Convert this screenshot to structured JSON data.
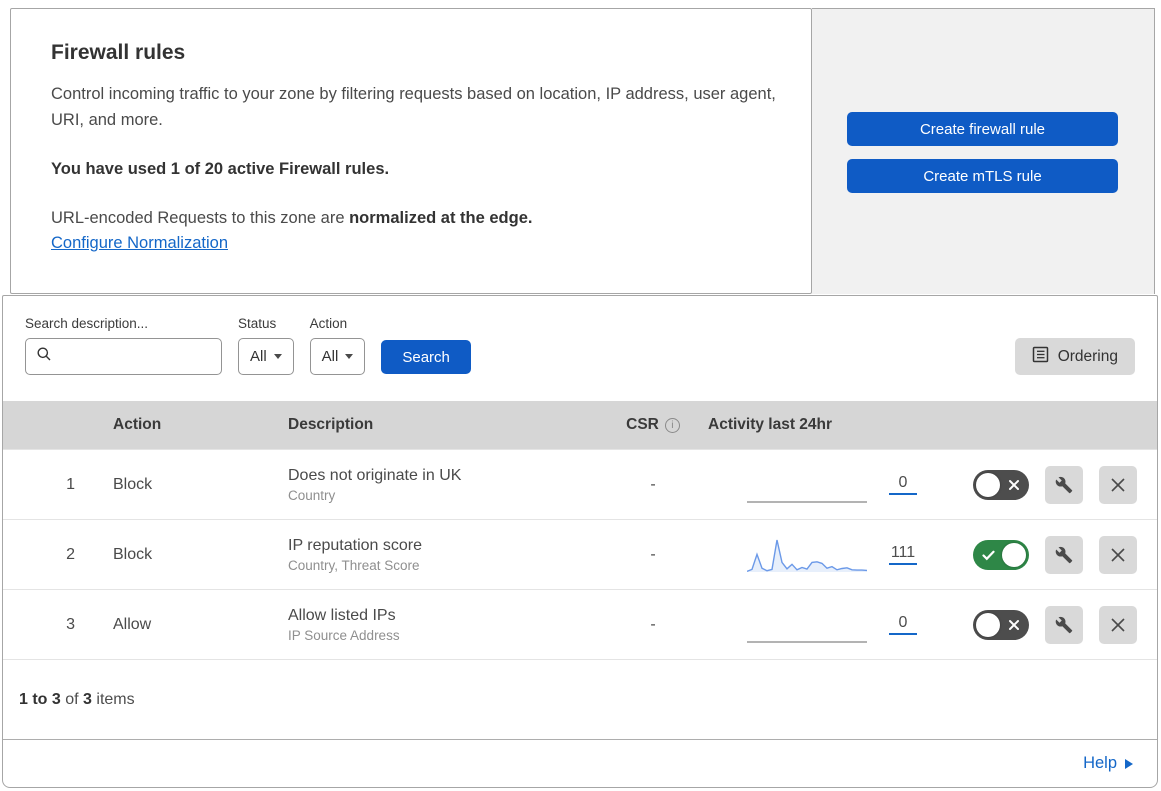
{
  "header": {
    "title": "Firewall rules",
    "description": "Control incoming traffic to your zone by filtering requests based on location, IP address, user agent, URI, and more.",
    "usage_notice": "You have used 1 of 20 active Firewall rules.",
    "normalization_text": "URL-encoded Requests to this zone are ",
    "normalization_bold": "normalized at the edge.",
    "normalization_link": "Configure Normalization"
  },
  "actions_panel": {
    "create_firewall_rule": "Create firewall rule",
    "create_mtls_rule": "Create mTLS rule"
  },
  "filters": {
    "search_label": "Search description...",
    "search_value": "",
    "status_label": "Status",
    "status_value": "All",
    "action_label": "Action",
    "action_value": "All",
    "search_button": "Search",
    "ordering_button": "Ordering"
  },
  "table": {
    "columns": {
      "action": "Action",
      "description": "Description",
      "csr": "CSR",
      "activity": "Activity last 24hr"
    },
    "rows": [
      {
        "priority": "1",
        "action": "Block",
        "description": "Does not originate in UK",
        "rule_fields": "Country",
        "csr": "-",
        "activity_count": "0",
        "enabled": false,
        "activity_sparkline": []
      },
      {
        "priority": "2",
        "action": "Block",
        "description": "IP reputation score",
        "rule_fields": "Country, Threat Score",
        "csr": "-",
        "activity_count": "111",
        "enabled": true,
        "activity_sparkline": [
          2,
          8,
          55,
          12,
          4,
          8,
          100,
          30,
          10,
          24,
          7,
          14,
          9,
          30,
          32,
          27,
          12,
          17,
          7,
          11,
          13,
          7,
          6,
          6,
          5
        ]
      },
      {
        "priority": "3",
        "action": "Allow",
        "description": "Allow listed IPs",
        "rule_fields": "IP Source Address",
        "csr": "-",
        "activity_count": "0",
        "enabled": false,
        "activity_sparkline": []
      }
    ]
  },
  "footer": {
    "range": "1 to 3",
    "of": " of ",
    "total": "3",
    "items": " items"
  },
  "help": {
    "label": "Help"
  },
  "icons": {
    "search": "magnifier",
    "ordering": "list-document",
    "info": "i",
    "wrench": "wrench",
    "close": "x",
    "toggle_on": "check",
    "toggle_off": "x",
    "help_arrow": "right-triangle"
  },
  "colors": {
    "primary_blue": "#0f5bc5",
    "link_blue": "#1467c8",
    "toggle_on_green": "#2e8747",
    "toggle_off_gray": "#4d4d4d",
    "panel_gray": "#f1f1f1",
    "table_header_gray": "#d6d6d6",
    "button_gray": "#d9d9d9",
    "sparkline_blue": "#6b99e8"
  }
}
